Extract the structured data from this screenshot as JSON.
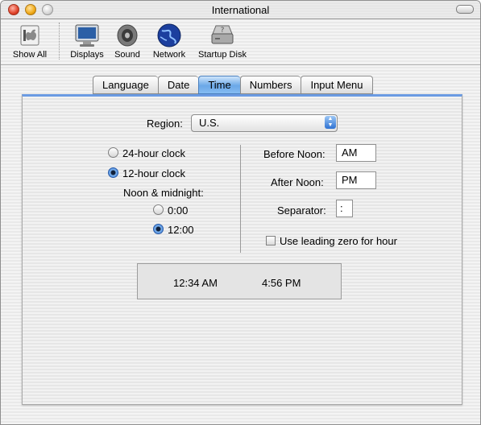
{
  "window": {
    "title": "International"
  },
  "toolbar": {
    "items": [
      {
        "label": "Show All",
        "icon": "apple-switch-icon"
      },
      {
        "label": "Displays",
        "icon": "monitor-icon"
      },
      {
        "label": "Sound",
        "icon": "speaker-icon"
      },
      {
        "label": "Network",
        "icon": "globe-icon"
      },
      {
        "label": "Startup Disk",
        "icon": "hard-disk-icon"
      }
    ]
  },
  "tabs": [
    {
      "label": "Language"
    },
    {
      "label": "Date"
    },
    {
      "label": "Time",
      "active": true
    },
    {
      "label": "Numbers"
    },
    {
      "label": "Input Menu"
    }
  ],
  "region": {
    "label": "Region:",
    "value": "U.S."
  },
  "clock": {
    "option_24": "24-hour clock",
    "option_12": "12-hour clock",
    "selected": "12-hour clock",
    "noon_label": "Noon & midnight:",
    "noon_option_0": "0:00",
    "noon_option_12": "12:00",
    "noon_selected": "12:00"
  },
  "fields": {
    "before_noon_label": "Before Noon:",
    "before_noon_value": "AM",
    "after_noon_label": "After Noon:",
    "after_noon_value": "PM",
    "separator_label": "Separator:",
    "separator_value": ":",
    "leading_zero_label": "Use leading zero for hour",
    "leading_zero_checked": false
  },
  "preview": {
    "time_am": "12:34 AM",
    "time_pm": "4:56 PM"
  }
}
